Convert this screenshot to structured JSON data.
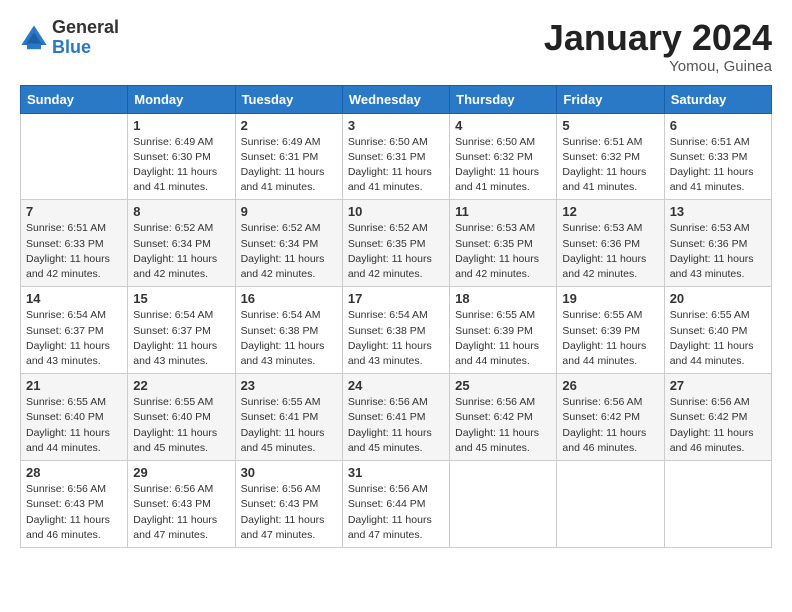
{
  "logo": {
    "general": "General",
    "blue": "Blue"
  },
  "title": "January 2024",
  "location": "Yomou, Guinea",
  "days_of_week": [
    "Sunday",
    "Monday",
    "Tuesday",
    "Wednesday",
    "Thursday",
    "Friday",
    "Saturday"
  ],
  "weeks": [
    [
      {
        "day": "",
        "info": ""
      },
      {
        "day": "1",
        "info": "Sunrise: 6:49 AM\nSunset: 6:30 PM\nDaylight: 11 hours\nand 41 minutes."
      },
      {
        "day": "2",
        "info": "Sunrise: 6:49 AM\nSunset: 6:31 PM\nDaylight: 11 hours\nand 41 minutes."
      },
      {
        "day": "3",
        "info": "Sunrise: 6:50 AM\nSunset: 6:31 PM\nDaylight: 11 hours\nand 41 minutes."
      },
      {
        "day": "4",
        "info": "Sunrise: 6:50 AM\nSunset: 6:32 PM\nDaylight: 11 hours\nand 41 minutes."
      },
      {
        "day": "5",
        "info": "Sunrise: 6:51 AM\nSunset: 6:32 PM\nDaylight: 11 hours\nand 41 minutes."
      },
      {
        "day": "6",
        "info": "Sunrise: 6:51 AM\nSunset: 6:33 PM\nDaylight: 11 hours\nand 41 minutes."
      }
    ],
    [
      {
        "day": "7",
        "info": "Sunrise: 6:51 AM\nSunset: 6:33 PM\nDaylight: 11 hours\nand 42 minutes."
      },
      {
        "day": "8",
        "info": "Sunrise: 6:52 AM\nSunset: 6:34 PM\nDaylight: 11 hours\nand 42 minutes."
      },
      {
        "day": "9",
        "info": "Sunrise: 6:52 AM\nSunset: 6:34 PM\nDaylight: 11 hours\nand 42 minutes."
      },
      {
        "day": "10",
        "info": "Sunrise: 6:52 AM\nSunset: 6:35 PM\nDaylight: 11 hours\nand 42 minutes."
      },
      {
        "day": "11",
        "info": "Sunrise: 6:53 AM\nSunset: 6:35 PM\nDaylight: 11 hours\nand 42 minutes."
      },
      {
        "day": "12",
        "info": "Sunrise: 6:53 AM\nSunset: 6:36 PM\nDaylight: 11 hours\nand 42 minutes."
      },
      {
        "day": "13",
        "info": "Sunrise: 6:53 AM\nSunset: 6:36 PM\nDaylight: 11 hours\nand 43 minutes."
      }
    ],
    [
      {
        "day": "14",
        "info": "Sunrise: 6:54 AM\nSunset: 6:37 PM\nDaylight: 11 hours\nand 43 minutes."
      },
      {
        "day": "15",
        "info": "Sunrise: 6:54 AM\nSunset: 6:37 PM\nDaylight: 11 hours\nand 43 minutes."
      },
      {
        "day": "16",
        "info": "Sunrise: 6:54 AM\nSunset: 6:38 PM\nDaylight: 11 hours\nand 43 minutes."
      },
      {
        "day": "17",
        "info": "Sunrise: 6:54 AM\nSunset: 6:38 PM\nDaylight: 11 hours\nand 43 minutes."
      },
      {
        "day": "18",
        "info": "Sunrise: 6:55 AM\nSunset: 6:39 PM\nDaylight: 11 hours\nand 44 minutes."
      },
      {
        "day": "19",
        "info": "Sunrise: 6:55 AM\nSunset: 6:39 PM\nDaylight: 11 hours\nand 44 minutes."
      },
      {
        "day": "20",
        "info": "Sunrise: 6:55 AM\nSunset: 6:40 PM\nDaylight: 11 hours\nand 44 minutes."
      }
    ],
    [
      {
        "day": "21",
        "info": "Sunrise: 6:55 AM\nSunset: 6:40 PM\nDaylight: 11 hours\nand 44 minutes."
      },
      {
        "day": "22",
        "info": "Sunrise: 6:55 AM\nSunset: 6:40 PM\nDaylight: 11 hours\nand 45 minutes."
      },
      {
        "day": "23",
        "info": "Sunrise: 6:55 AM\nSunset: 6:41 PM\nDaylight: 11 hours\nand 45 minutes."
      },
      {
        "day": "24",
        "info": "Sunrise: 6:56 AM\nSunset: 6:41 PM\nDaylight: 11 hours\nand 45 minutes."
      },
      {
        "day": "25",
        "info": "Sunrise: 6:56 AM\nSunset: 6:42 PM\nDaylight: 11 hours\nand 45 minutes."
      },
      {
        "day": "26",
        "info": "Sunrise: 6:56 AM\nSunset: 6:42 PM\nDaylight: 11 hours\nand 46 minutes."
      },
      {
        "day": "27",
        "info": "Sunrise: 6:56 AM\nSunset: 6:42 PM\nDaylight: 11 hours\nand 46 minutes."
      }
    ],
    [
      {
        "day": "28",
        "info": "Sunrise: 6:56 AM\nSunset: 6:43 PM\nDaylight: 11 hours\nand 46 minutes."
      },
      {
        "day": "29",
        "info": "Sunrise: 6:56 AM\nSunset: 6:43 PM\nDaylight: 11 hours\nand 47 minutes."
      },
      {
        "day": "30",
        "info": "Sunrise: 6:56 AM\nSunset: 6:43 PM\nDaylight: 11 hours\nand 47 minutes."
      },
      {
        "day": "31",
        "info": "Sunrise: 6:56 AM\nSunset: 6:44 PM\nDaylight: 11 hours\nand 47 minutes."
      },
      {
        "day": "",
        "info": ""
      },
      {
        "day": "",
        "info": ""
      },
      {
        "day": "",
        "info": ""
      }
    ]
  ]
}
